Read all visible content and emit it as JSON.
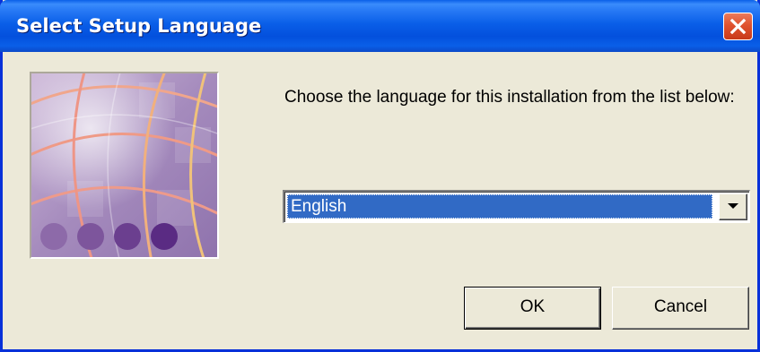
{
  "window": {
    "title": "Select Setup Language"
  },
  "icons": {
    "close": "close-icon",
    "dropdown": "chevron-down-icon",
    "logo": "setup-globe-logo"
  },
  "content": {
    "prompt": "Choose the language for this installation from the list below:"
  },
  "language_select": {
    "selected": "English"
  },
  "buttons": {
    "ok_label": "OK",
    "cancel_label": "Cancel"
  },
  "colors": {
    "titlebar": "#0a5fe8",
    "face": "#ece9d8",
    "selection": "#316ac5",
    "close_button": "#e0532f"
  }
}
